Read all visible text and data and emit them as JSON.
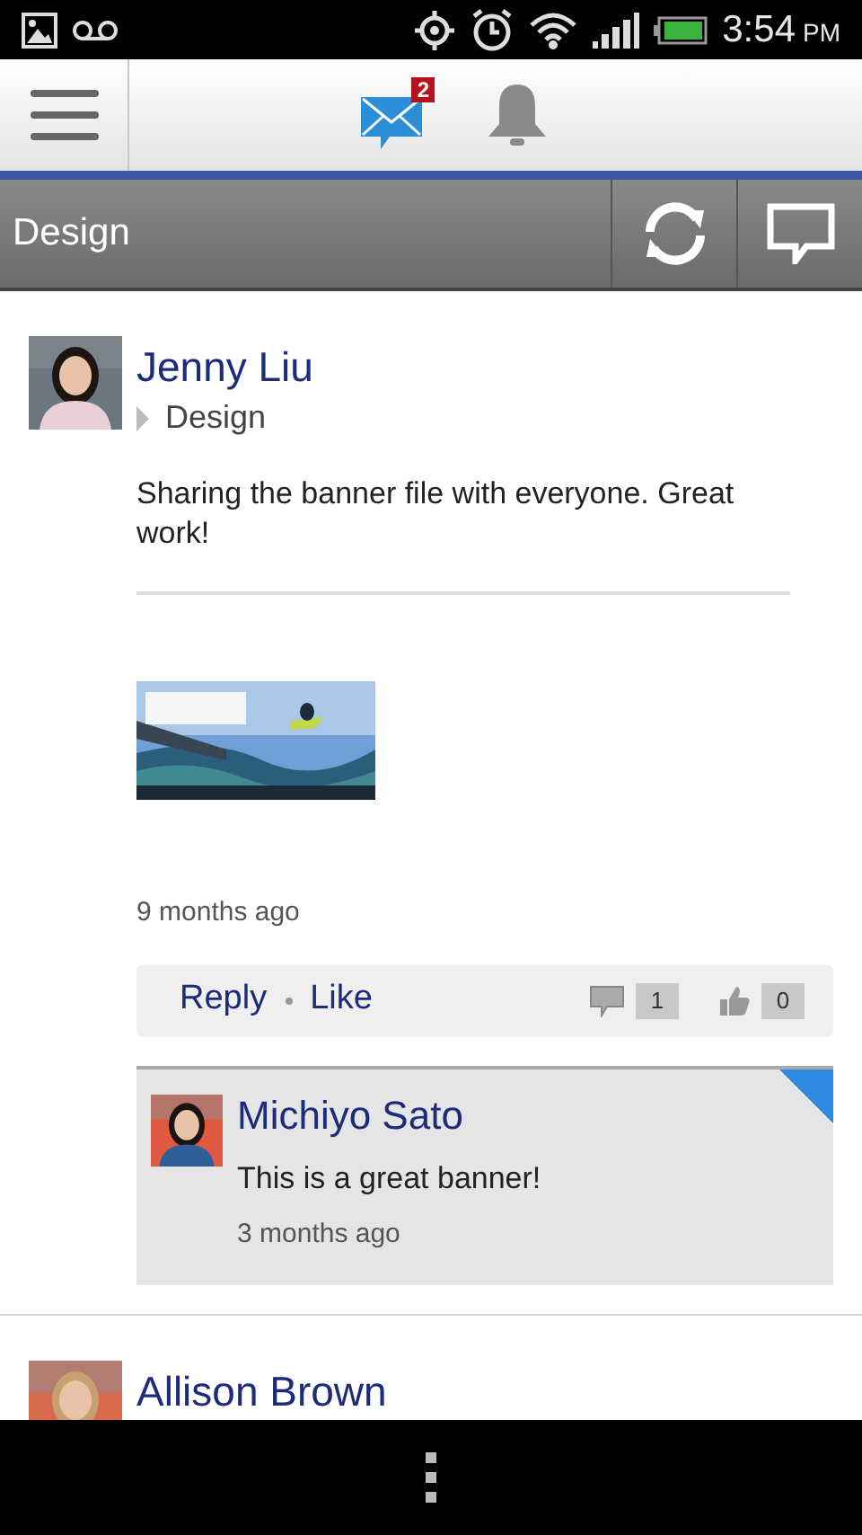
{
  "status_bar": {
    "time": "3:54",
    "meridiem": "PM"
  },
  "header": {
    "messages_badge": "2"
  },
  "section_bar": {
    "title": "Design"
  },
  "posts": [
    {
      "author": "Jenny Liu",
      "group": "Design",
      "text": "Sharing the banner file with everyone. Great work!",
      "attachment": {
        "kind": "picture"
      },
      "time": "9 months ago",
      "actions": [
        "Reply",
        "Like"
      ],
      "comment_count": "1",
      "like_count": "0",
      "comments": [
        {
          "author": "Michiyo Sato",
          "text": "This is a great banner!",
          "time": "3 months ago",
          "unread": true
        }
      ]
    },
    {
      "author": "Allison Brown"
    }
  ]
}
